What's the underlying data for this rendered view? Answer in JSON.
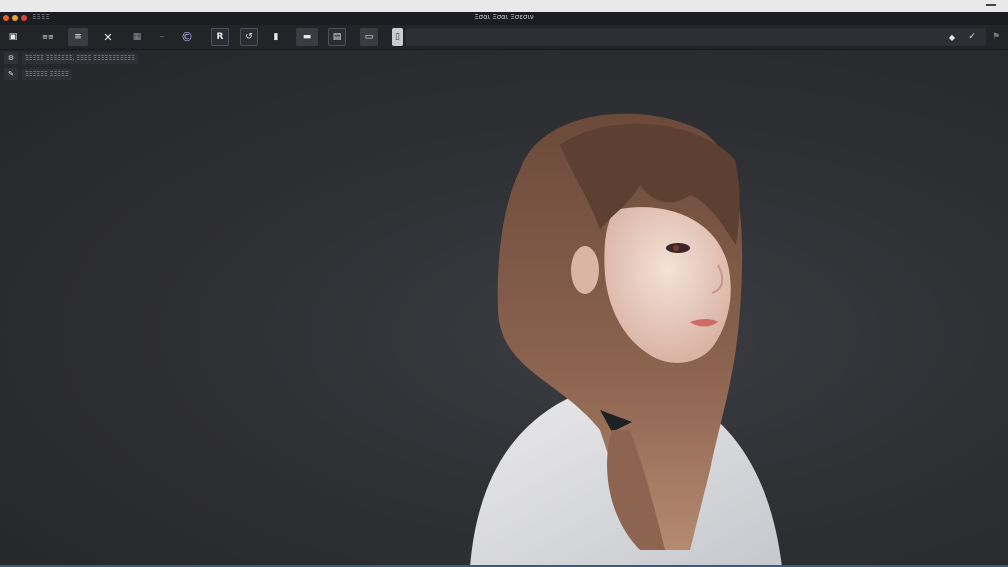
{
  "window": {
    "title": "Ξσαι Ξσαι Ξσεσιν",
    "app_name": "ΞΞΞΞ"
  },
  "toolbar": {
    "items": [
      {
        "icon": "image-icon",
        "glyph": "▣"
      },
      {
        "icon": "zoom-icon",
        "label": "≡≡"
      },
      {
        "icon": "menu-icon",
        "glyph": "≡"
      },
      {
        "icon": "close-icon",
        "glyph": "✕"
      },
      {
        "icon": "grid-icon",
        "glyph": "▦"
      },
      {
        "icon": "minus-icon",
        "glyph": "–"
      },
      {
        "icon": "copyright-icon",
        "glyph": "©"
      },
      {
        "icon": "letter-r-icon",
        "glyph": "R"
      },
      {
        "icon": "rotate-icon",
        "glyph": "↺"
      },
      {
        "icon": "marker-icon",
        "glyph": "▮"
      },
      {
        "icon": "monitor-icon",
        "glyph": "▬"
      },
      {
        "icon": "document-icon",
        "glyph": "▤"
      },
      {
        "icon": "window-icon",
        "glyph": "▭"
      },
      {
        "icon": "page-icon",
        "glyph": "▯"
      },
      {
        "icon": "brush-icon",
        "glyph": "◆"
      },
      {
        "icon": "check-icon",
        "glyph": "✓"
      },
      {
        "icon": "flag-icon",
        "glyph": "⚑"
      }
    ]
  },
  "sidebar": {
    "items": [
      {
        "icon": "settings-icon",
        "glyph": "⚙",
        "label": "ΞΞΞΞΞ ΞΞΞΞΞΞΞ, ΞΞΞΞ ΞΞΞΞΞΞΞΞΞΞΞ"
      },
      {
        "icon": "pen-icon",
        "glyph": "✎",
        "label": "ΞΞΞΞΞΞ ΞΞΞΞΞ"
      }
    ]
  },
  "colors": {
    "traffic": [
      "#e0632a",
      "#e8a23a",
      "#d8463b"
    ],
    "background": "#2a2b2f",
    "accent": "#3a5a7c"
  },
  "canvas": {
    "subject": "portrait-illustration"
  }
}
